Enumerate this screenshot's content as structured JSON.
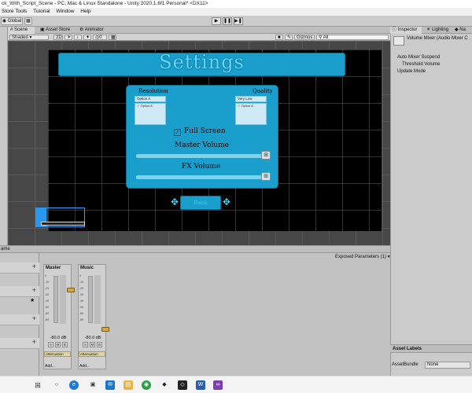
{
  "window": {
    "title": "ck_With_Script_Scene - PC, Mac & Linux Standalone - Unity 2020.1.6f1 Personal* <DX11>"
  },
  "menu": [
    "Store Tools",
    "Tutorial",
    "Window",
    "Help"
  ],
  "toolbar": {
    "global_label": "Global",
    "play_icon": "play-icon",
    "pause_icon": "pause-icon",
    "step_icon": "step-icon"
  },
  "scene_tabs": [
    "Scene",
    "Asset Store",
    "Animator"
  ],
  "scene_bar": {
    "shading": "Shaded",
    "mode_2d": "2D",
    "gizmos": "Gizmos",
    "search_placeholder": "All",
    "layer_count": "0"
  },
  "game_ui": {
    "title": "Settings",
    "resolution_label": "Resolution",
    "quality_label": "Quality",
    "resolution_value": "Option A",
    "resolution_list_item": "✓ Option A",
    "quality_value": "Very Low",
    "quality_list_item": "✓ Option A",
    "fullscreen_label": "Full Screen",
    "fullscreen_checked": true,
    "master_volume_label": "Master Volume",
    "fx_volume_label": "FX Volume",
    "back_label": "Back",
    "colors": {
      "panel": "#1a9fcc",
      "title": "#5fd8ff",
      "slider": "#7ed3ec"
    }
  },
  "right_tabs": [
    "Inspector",
    "Lighting",
    "Na"
  ],
  "inspector": {
    "component_title": "Volume Mixer (Audio Mixer C",
    "rows": [
      "Auto Mixer Suspend",
      "Threshold Volume",
      "Update Mode"
    ],
    "asset_labels_title": "Asset Labels",
    "asset_bundle_label": "AssetBundle",
    "asset_bundle_value": "None"
  },
  "audio_mixer": {
    "header_left": "ame",
    "exposed_params": "Exposed Parameters (1)",
    "strips": [
      {
        "name": "Master",
        "db": "-80.0 dB",
        "buttons": [
          "S",
          "M",
          "B"
        ],
        "effect": "Attenuation",
        "add": "Add..."
      },
      {
        "name": "Music",
        "db": "-80.0 dB",
        "buttons": [
          "S",
          "M",
          "B"
        ],
        "effect": "Attenuation",
        "add": "Add..."
      }
    ],
    "scale": [
      "0",
      "-10",
      "-20",
      "-30",
      "-40",
      "-50",
      "-60",
      "-80"
    ]
  },
  "taskbar": {
    "icons": [
      "windows-icon",
      "search-icon",
      "task-view-icon",
      "edge-icon",
      "store-icon",
      "mail-icon",
      "explorer-icon",
      "chrome-icon",
      "unity-hub-icon",
      "unity-icon",
      "word-icon",
      "visual-studio-icon"
    ]
  }
}
